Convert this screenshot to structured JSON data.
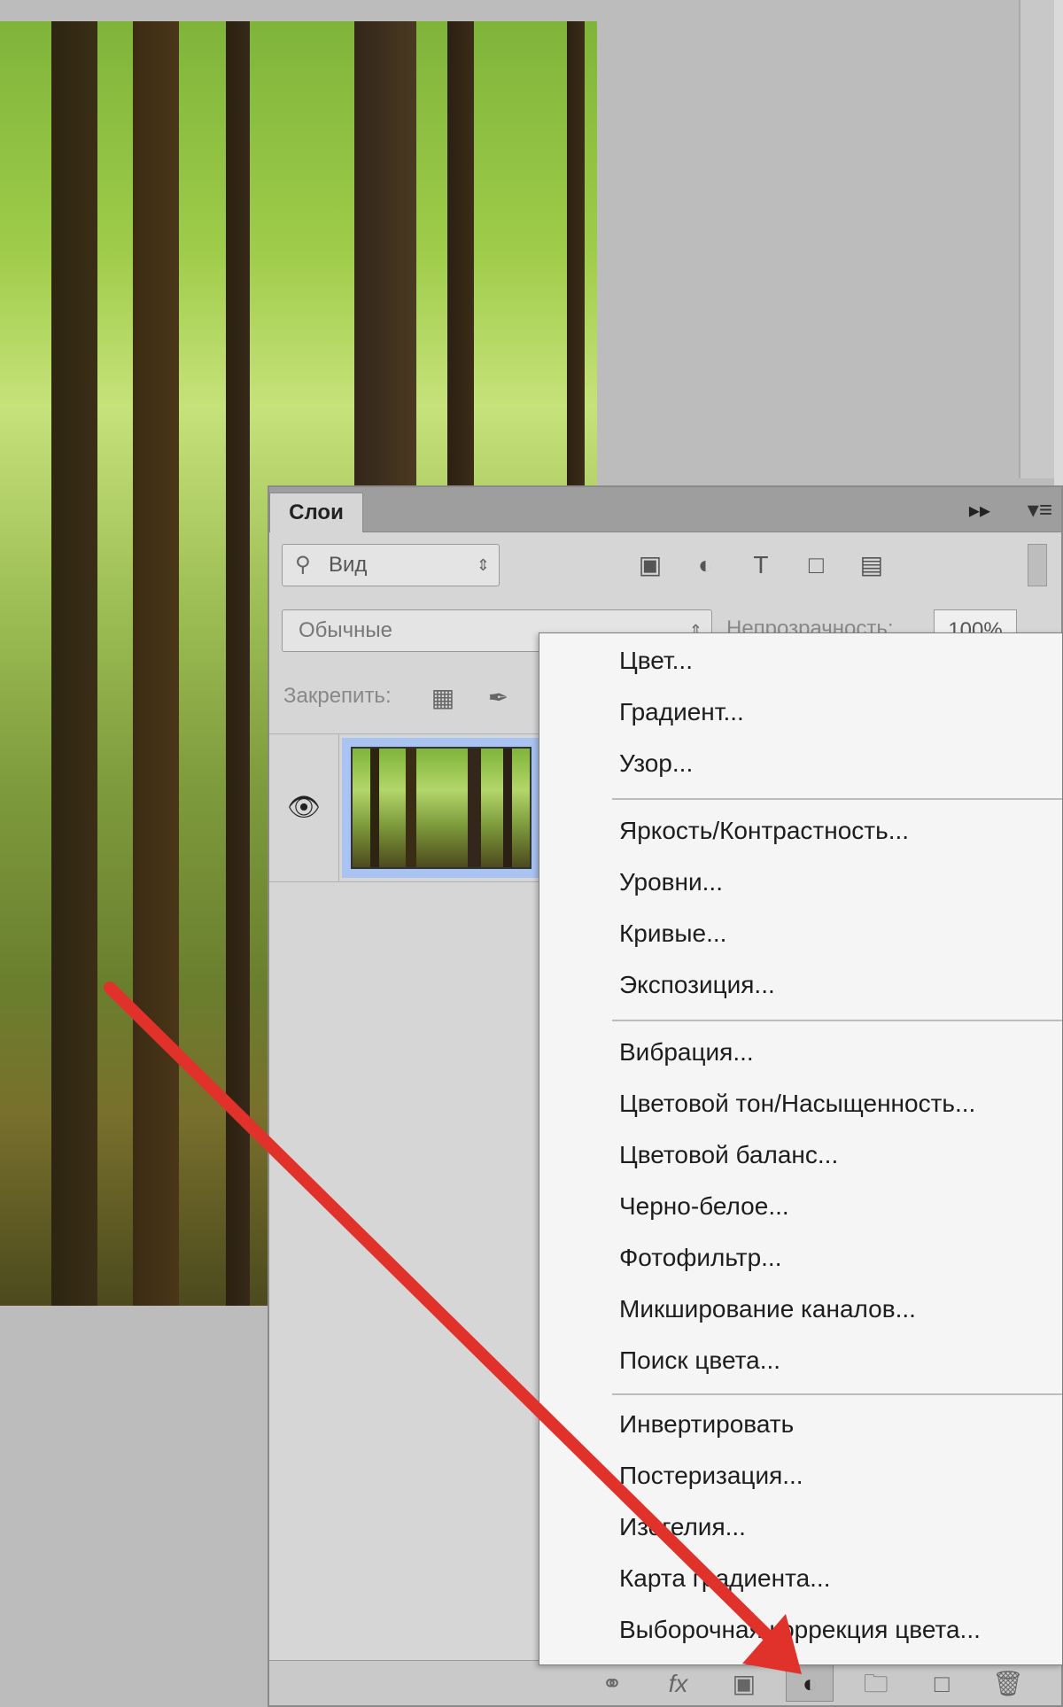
{
  "panel": {
    "tab_title": "Слои",
    "collapse_icon": "double-chevron-right",
    "menu_icon": "panel-menu",
    "filter": {
      "label": "Вид",
      "icons": [
        "image-filter-icon",
        "adjustment-filter-icon",
        "type-filter-icon",
        "shape-filter-icon",
        "smart-object-filter-icon"
      ]
    },
    "blend_mode": "Обычные",
    "opacity_label": "Непрозрачность:",
    "opacity_value": "100%",
    "lock_label": "Закрепить:",
    "lock_icons": [
      "lock-transparent-icon",
      "lock-image-icon",
      "lock-position-icon"
    ],
    "layers": [
      {
        "visible": true,
        "thumbnail": "forest"
      }
    ],
    "footer_icons": [
      "link-icon",
      "fx-icon",
      "mask-icon",
      "adjustment-layer-icon",
      "group-folder-icon",
      "new-layer-icon",
      "trash-icon"
    ]
  },
  "adjust_menu": {
    "groups": [
      [
        "Цвет...",
        "Градиент...",
        "Узор..."
      ],
      [
        "Яркость/Контрастность...",
        "Уровни...",
        "Кривые...",
        "Экспозиция..."
      ],
      [
        "Вибрация...",
        "Цветовой тон/Насыщенность...",
        "Цветовой баланс...",
        "Черно-белое...",
        "Фотофильтр...",
        "Микширование каналов...",
        "Поиск цвета..."
      ],
      [
        "Инвертировать",
        "Постеризация...",
        "Изогелия...",
        "Карта градиента...",
        "Выборочная коррекция цвета..."
      ]
    ]
  },
  "annotation": {
    "arrow_color": "#e0322a"
  }
}
